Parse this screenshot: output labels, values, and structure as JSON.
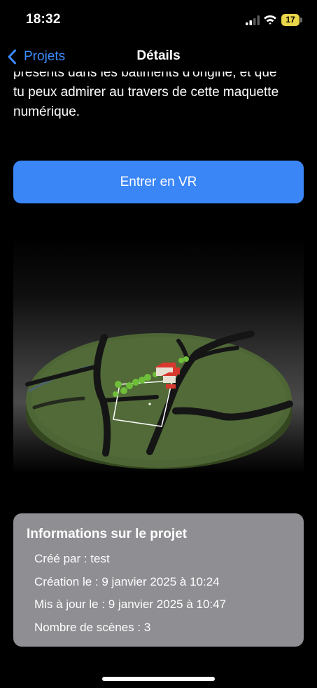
{
  "status_bar": {
    "time": "18:32",
    "battery_level": "17",
    "icons": [
      "signal-icon",
      "wifi-icon",
      "battery-icon"
    ]
  },
  "nav": {
    "back_label": "Projets",
    "title": "Détails",
    "back_icon": "chevron-left-icon"
  },
  "description": {
    "lines": [
      "présents dans les bâtiments d'origine, et que",
      "tu peux admirer au travers de cette maquette",
      "numérique."
    ]
  },
  "vr_button": {
    "label": "Entrer en VR"
  },
  "info": {
    "title": "Informations sur le projet",
    "created_by": "Créé par : test",
    "created_at": "Création le : 9 janvier 2025 à 10:24",
    "updated_at": "Mis à jour le : 9 janvier 2025 à 10:47",
    "scene_count": "Nombre de scènes : 3"
  },
  "colors": {
    "accent": "#3a86f7",
    "link": "#3b8cff",
    "card": "#8e8e93",
    "battery": "#e9d64a",
    "terrain": "#4e6636",
    "roof": "#d9382f"
  }
}
